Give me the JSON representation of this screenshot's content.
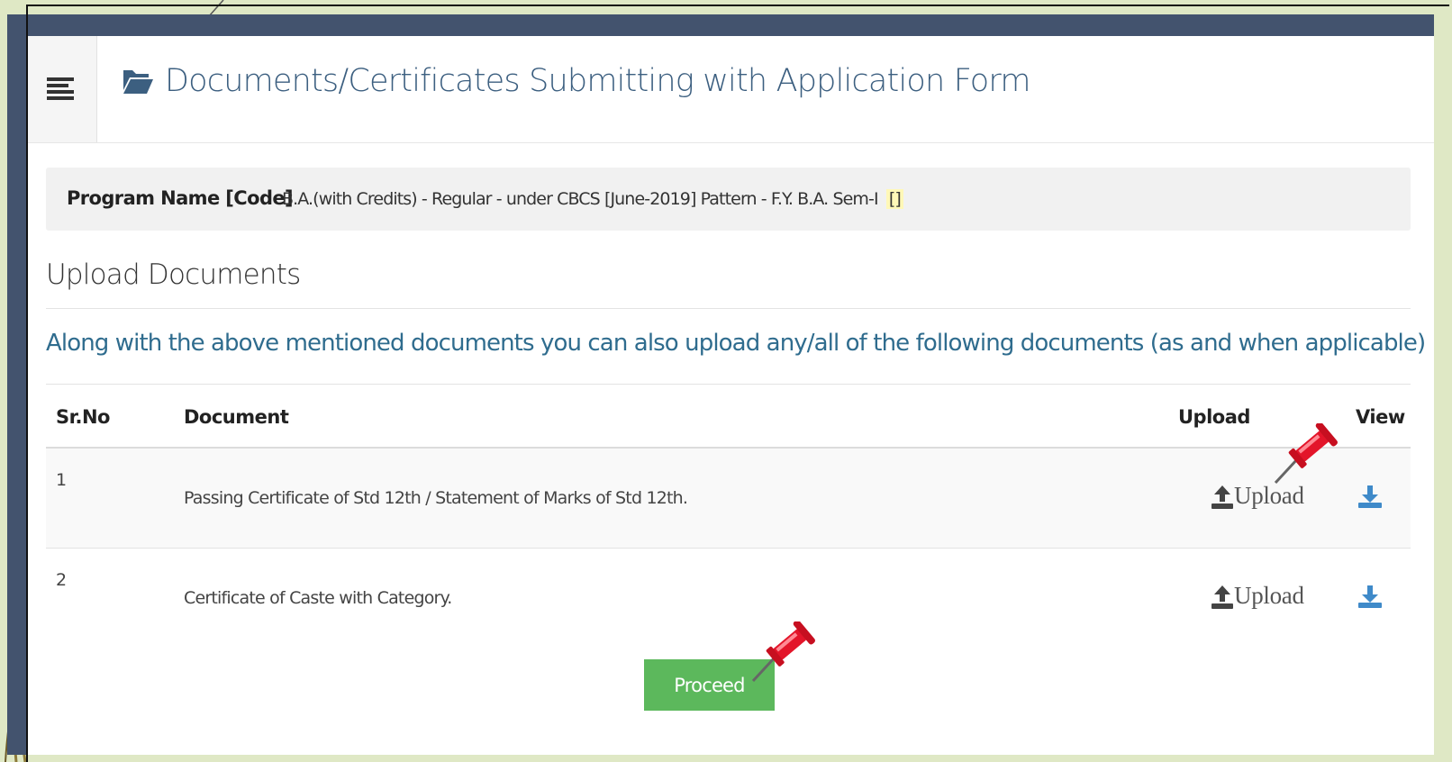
{
  "header": {
    "title": "Documents/Certificates Submitting with Application Form",
    "menu_icon": "menu-icon",
    "title_icon": "folder-open-icon"
  },
  "program": {
    "label": "Program Name [Code]",
    "value": "B.A.(with Credits) - Regular - under CBCS [June-2019] Pattern - F.Y. B.A. Sem-I",
    "code": "[]"
  },
  "upload_section": {
    "title": "Upload Documents",
    "instructions": "Along with the above mentioned documents you can also upload any/all of the following documents (as and when applicable)"
  },
  "table": {
    "headers": {
      "sr_no": "Sr.No",
      "document": "Document",
      "upload": "Upload",
      "view": "View"
    },
    "rows": [
      {
        "sr_no": "1",
        "document": "Passing Certificate of Std 12th / Statement of Marks of Std 12th.",
        "upload_label": "Upload"
      },
      {
        "sr_no": "2",
        "document": "Certificate of Caste with Category.",
        "upload_label": "Upload"
      }
    ]
  },
  "actions": {
    "proceed_label": "Proceed"
  },
  "colors": {
    "title": "#3c5f80",
    "instructions": "#2f6c8e",
    "proceed": "#5cb85c",
    "view_icon": "#3f8ac9",
    "frame": "#43536e",
    "pin": "#e3152a"
  }
}
